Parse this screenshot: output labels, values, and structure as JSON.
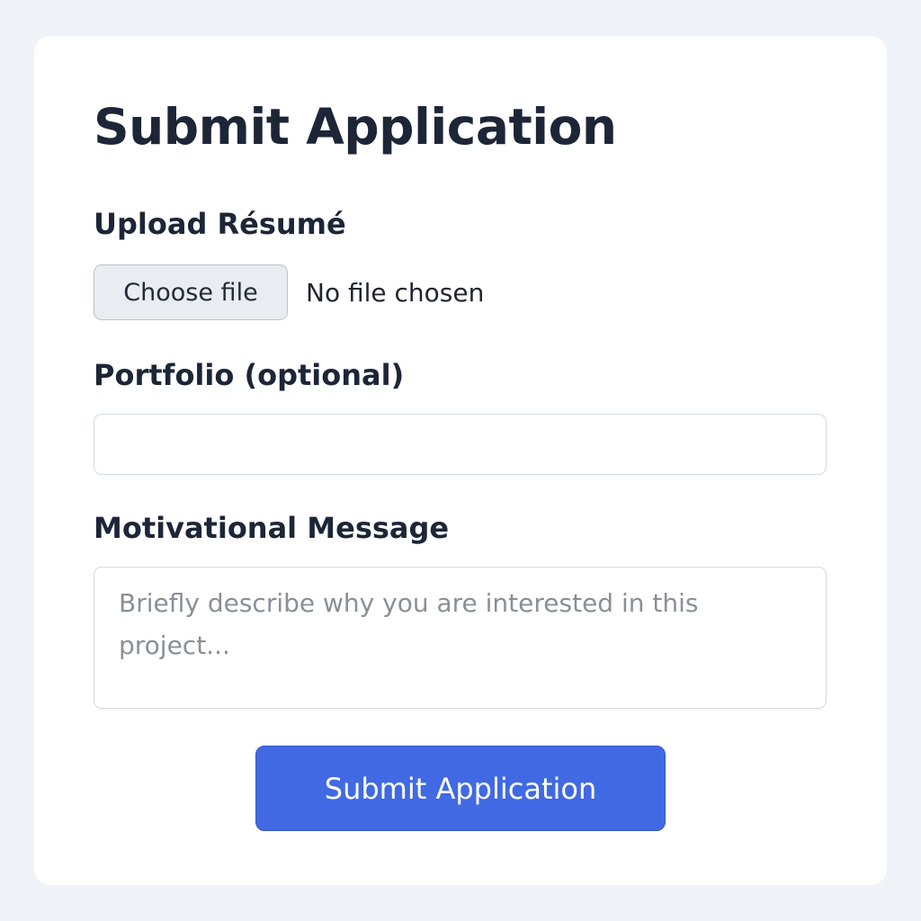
{
  "form": {
    "title": "Submit Application",
    "resume": {
      "label": "Upload Résumé",
      "button_label": "Choose file",
      "status": "No file chosen"
    },
    "portfolio": {
      "label": "Portfolio (optional)",
      "value": ""
    },
    "message": {
      "label": "Motivational Message",
      "placeholder": "Briefly describe why you are interested in this project..."
    },
    "submit_label": "Submit Application"
  },
  "colors": {
    "page_background": "#eff2f6",
    "card_background": "#ffffff",
    "heading_text": "#1c2637",
    "primary_button": "#4069e3",
    "file_button_background": "#e9edf2"
  }
}
